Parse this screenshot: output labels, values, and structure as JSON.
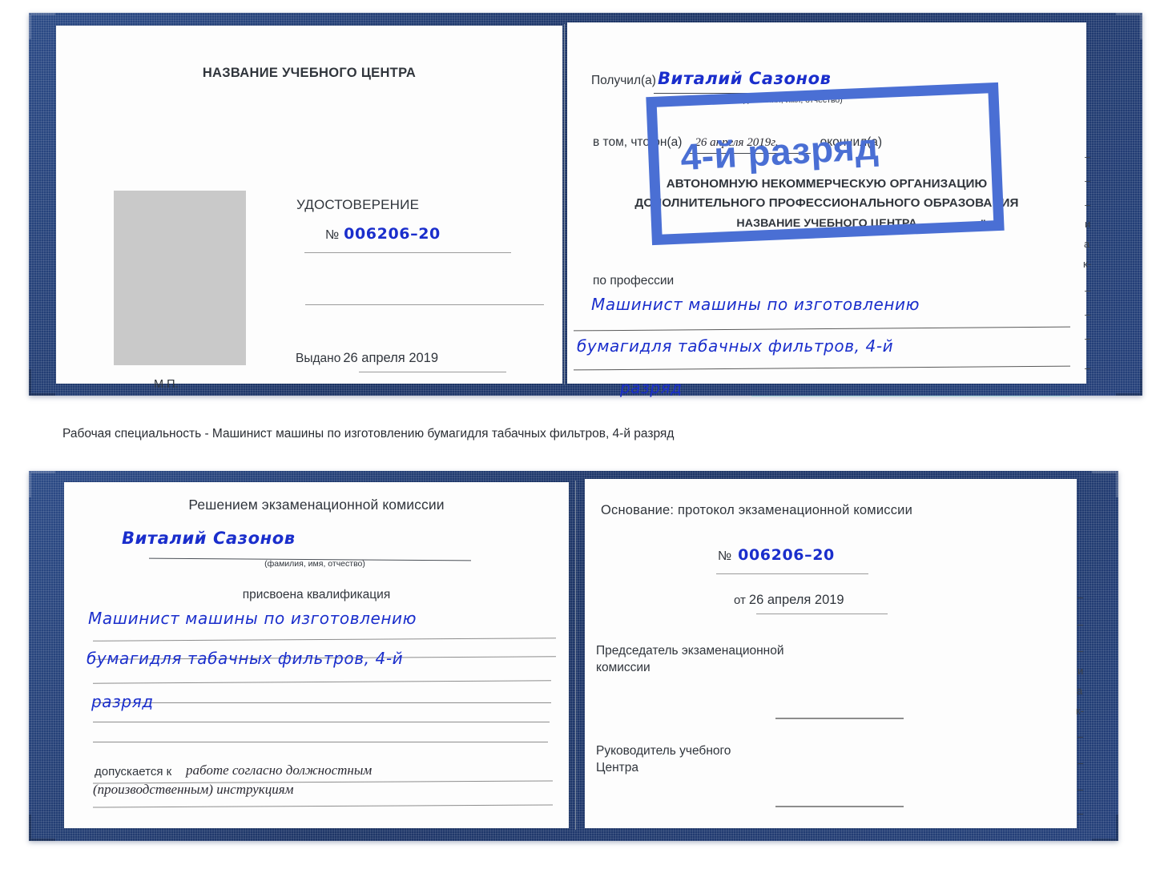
{
  "caption": "Рабочая специальность - Машинист машины по изготовлению бумагидля табачных фильтров, 4-й разряд",
  "colors": {
    "cover_blue": "#1d3566",
    "stamp_blue": "#4a6fd4",
    "ink_blue": "#1a2ecc",
    "photo_gray": "#c9c9c9"
  },
  "stamp": {
    "text": "4-й разряд"
  },
  "cert_top": {
    "left_page": {
      "center_name": "НАЗВАНИЕ УЧЕБНОГО ЦЕНТРА",
      "photo_placeholder": "photo-placeholder",
      "stamp_place_label": "М.П.",
      "title": "УДОСТОВЕРЕНИЕ",
      "number_label": "№",
      "number_value": "006206–20",
      "issued_label": "Выдано",
      "issued_value": "26 апреля 2019"
    },
    "right_page": {
      "received_label": "Получил(а)",
      "received_value": "Виталий Сазонов",
      "fio_hint": "(фамилия, имя, отчество)",
      "that_label": "в том, что он(а)",
      "that_date": "26 апреля 2019г.",
      "finished_label": "окончил(а)",
      "org_line1": "АВТОНОМНУЮ НЕКОММЕРЧЕСКУЮ ОРГАНИЗАЦИЮ",
      "org_line2": "ДОПОЛНИТЕЛЬНОГО ПРОФЕССИОНАЛЬНОГО ОБРАЗОВАНИЯ",
      "org_line3": "НАЗВАНИЕ УЧЕБНОГО ЦЕНТРА",
      "quote_open": "\"",
      "quote_close": "\"",
      "profession_label": "по профессии",
      "profession_line1": "Машинист машины по изготовлению",
      "profession_line2": "бумагидля табачных фильтров, 4-й",
      "profession_line3": "разряд"
    },
    "edge_fragments": [
      "–",
      "–",
      "–",
      "и",
      "а",
      "к-",
      "–",
      "–",
      "–",
      "–"
    ]
  },
  "cert_bottom": {
    "left_page": {
      "title": "Решением экзаменационной комиссии",
      "name_value": "Виталий Сазонов",
      "fio_hint": "(фамилия, имя, отчество)",
      "qualification_label": "присвоена квалификация",
      "qualification_line1": "Машинист машины по изготовлению",
      "qualification_line2": "бумагидля табачных фильтров, 4-й",
      "qualification_line3": "разряд",
      "admitted_label": "допускается к",
      "admitted_value_line1": "работе согласно должностным",
      "admitted_value_line2": "(производственным) инструкциям"
    },
    "right_page": {
      "basis_label": "Основание: протокол экзаменационной комиссии",
      "number_label": "№",
      "number_value": "006206–20",
      "date_label": "от",
      "date_value": "26 апреля 2019",
      "chairman_line1": "Председатель экзаменационной",
      "chairman_line2": "комиссии",
      "head_line1": "Руководитель учебного",
      "head_line2": "Центра"
    },
    "edge_fragments": [
      "–",
      "–",
      "–",
      "и",
      "а",
      "к-",
      "–",
      "–",
      "–",
      "–"
    ]
  }
}
